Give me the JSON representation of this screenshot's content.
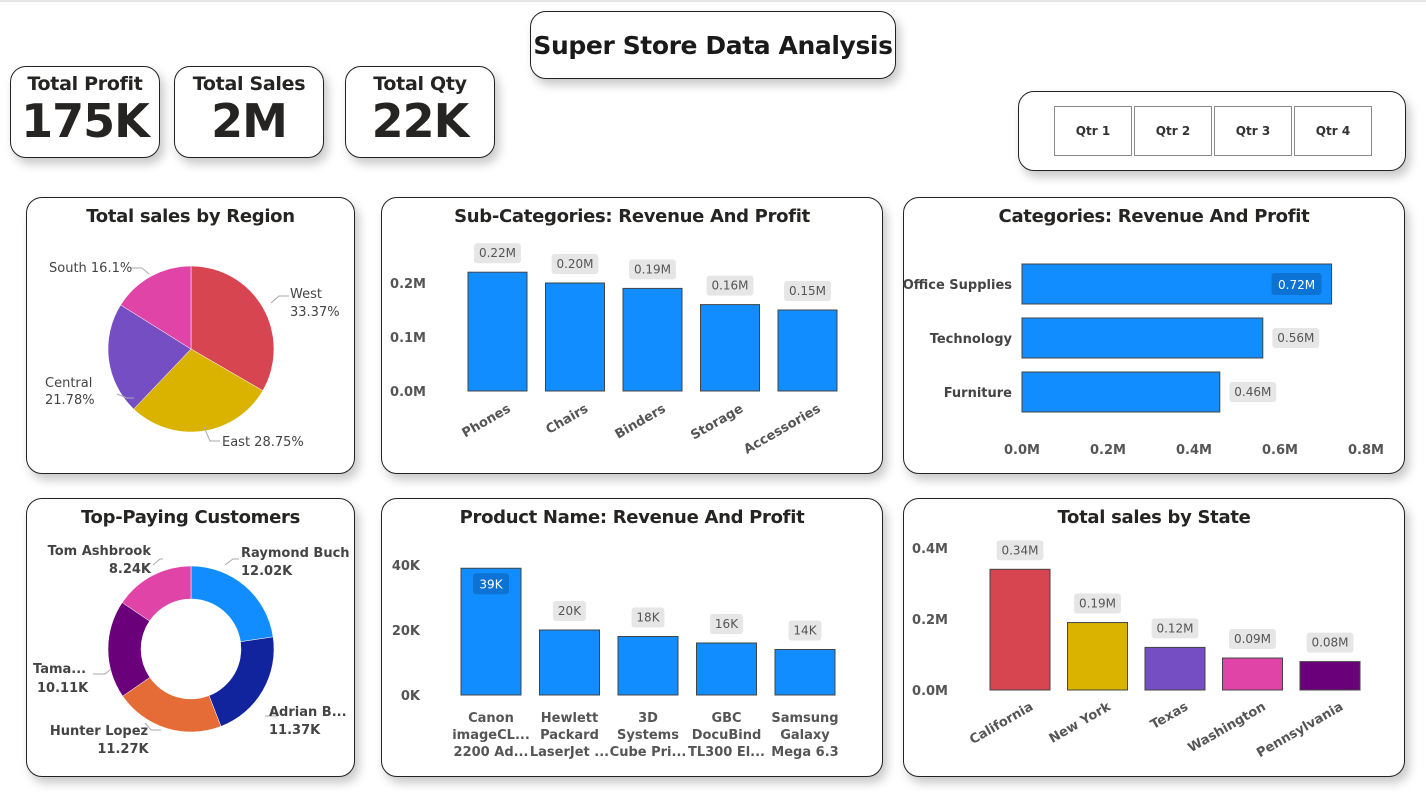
{
  "title": "Super Store Data Analysis",
  "kpis": [
    {
      "label": "Total Profit",
      "value": "175K"
    },
    {
      "label": "Total Sales",
      "value": "2M"
    },
    {
      "label": "Total Qty",
      "value": "22K"
    }
  ],
  "quarters": [
    "Qtr 1",
    "Qtr 2",
    "Qtr 3",
    "Qtr 4"
  ],
  "colors": {
    "bar_blue": "#118dff",
    "label_bg": "#e6e6e6",
    "axis_text": "#555555",
    "border": "#222222"
  },
  "chart_data": [
    {
      "id": "region",
      "type": "pie",
      "title": "Total sales by Region",
      "labels": [
        "West",
        "East",
        "Central",
        "South"
      ],
      "label_text": [
        "33.37%",
        "East 28.75%",
        "21.78%",
        "South 16.1%"
      ],
      "values": [
        33.37,
        28.75,
        21.78,
        16.1
      ],
      "colors": [
        "#d64550",
        "#d9b300",
        "#744ec2",
        "#e044a7"
      ]
    },
    {
      "id": "subcat",
      "type": "bar",
      "title": "Sub-Categories: Revenue And Profit",
      "categories": [
        "Phones",
        "Chairs",
        "Binders",
        "Storage",
        "Accessories"
      ],
      "values": [
        0.22,
        0.2,
        0.19,
        0.16,
        0.15
      ],
      "data_labels": [
        "0.22M",
        "0.20M",
        "0.19M",
        "0.16M",
        "0.15M"
      ],
      "ticks": [
        "0.0M",
        "0.1M",
        "0.2M"
      ],
      "tick_values": [
        0,
        0.1,
        0.2
      ],
      "ylim": [
        0,
        0.2
      ]
    },
    {
      "id": "category",
      "type": "bar",
      "orientation": "horizontal",
      "title": "Categories: Revenue And Profit",
      "categories": [
        "Office Supplies",
        "Technology",
        "Furniture"
      ],
      "values": [
        0.72,
        0.56,
        0.46
      ],
      "data_labels": [
        "0.72M",
        "0.56M",
        "0.46M"
      ],
      "ticks": [
        "0.0M",
        "0.2M",
        "0.4M",
        "0.6M",
        "0.8M"
      ],
      "tick_values": [
        0,
        0.2,
        0.4,
        0.6,
        0.8
      ],
      "xlim": [
        0,
        0.8
      ]
    },
    {
      "id": "customers",
      "type": "pie",
      "donut": true,
      "title": "Top-Paying Customers",
      "labels": [
        "Raymond Buch",
        "Adrian B...",
        "Hunter Lopez",
        "Tama...",
        "Tom Ashbrook"
      ],
      "value_labels": [
        "12.02K",
        "11.37K",
        "11.27K",
        "10.11K",
        "8.24K"
      ],
      "values": [
        12.02,
        11.37,
        11.27,
        10.11,
        8.24
      ],
      "colors": [
        "#118dff",
        "#12239e",
        "#e66c37",
        "#6b007b",
        "#e044a7"
      ]
    },
    {
      "id": "product",
      "type": "bar",
      "title": "Product Name: Revenue And Profit",
      "categories": [
        "Canon imageCL... 2200 Ad...",
        "Hewlett Packard LaserJet ...",
        "3D Systems Cube Pri...",
        "GBC DocuBind TL300 El...",
        "Samsung Galaxy Mega 6.3"
      ],
      "category_lines": [
        [
          "Canon",
          "imageCL...",
          "2200 Ad..."
        ],
        [
          "Hewlett",
          "Packard",
          "LaserJet ..."
        ],
        [
          "3D",
          "Systems",
          "Cube Pri..."
        ],
        [
          "GBC",
          "DocuBind",
          "TL300 El..."
        ],
        [
          "Samsung",
          "Galaxy",
          "Mega 6.3"
        ]
      ],
      "values": [
        39,
        20,
        18,
        16,
        14
      ],
      "data_labels": [
        "39K",
        "20K",
        "18K",
        "16K",
        "14K"
      ],
      "ticks": [
        "0K",
        "20K",
        "40K"
      ],
      "tick_values": [
        0,
        20,
        40
      ],
      "ylim": [
        0,
        40
      ]
    },
    {
      "id": "state",
      "type": "bar",
      "title": "Total sales by State",
      "categories": [
        "California",
        "New York",
        "Texas",
        "Washington",
        "Pennsylvania"
      ],
      "values": [
        0.34,
        0.19,
        0.12,
        0.09,
        0.08
      ],
      "data_labels": [
        "0.34M",
        "0.19M",
        "0.12M",
        "0.09M",
        "0.08M"
      ],
      "ticks": [
        "0.0M",
        "0.2M",
        "0.4M"
      ],
      "tick_values": [
        0,
        0.2,
        0.4
      ],
      "ylim": [
        0,
        0.4
      ],
      "colors": [
        "#d64550",
        "#d9b300",
        "#744ec2",
        "#e044a7",
        "#6b007b"
      ]
    }
  ]
}
